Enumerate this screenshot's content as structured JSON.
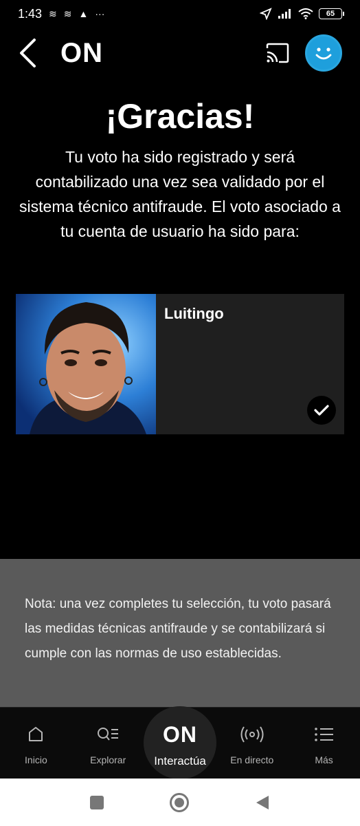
{
  "status_bar": {
    "time": "1:43",
    "left_icons": [
      "layers-icon",
      "layers-icon",
      "warning-icon",
      "more-dots-icon"
    ],
    "right_icons": [
      "location-arrow-icon",
      "signal-icon",
      "wifi-icon"
    ],
    "battery": "65"
  },
  "header": {
    "title": "ON",
    "back_icon": "chevron-left-icon",
    "cast_icon": "cast-icon",
    "avatar_icon": "smiley-avatar-icon",
    "accent_color": "#1e9fdc"
  },
  "confirmation": {
    "title": "¡Gracias!",
    "body": "Tu voto ha sido registrado y será contabilizado una vez sea validado por el sistema técnico antifraude. El voto asociado a tu cuenta de usuario ha sido para:"
  },
  "vote_card": {
    "candidate_name": "Luitingo",
    "selected": true,
    "check_icon": "check-icon"
  },
  "note": {
    "text": "Nota: una vez completes tu selección, tu voto pasará las medidas técnicas antifraude y se contabilizará si cumple con las normas de uso establecidas."
  },
  "bottom_nav": {
    "items": [
      {
        "label": "Inicio",
        "icon": "home-icon"
      },
      {
        "label": "Explorar",
        "icon": "explore-icon"
      },
      {
        "label": "Interactúa",
        "icon": "on-logo-icon",
        "logo_text": "ON",
        "active": true
      },
      {
        "label": "En directo",
        "icon": "live-broadcast-icon"
      },
      {
        "label": "Más",
        "icon": "menu-list-icon"
      }
    ]
  },
  "system_nav": {
    "icons": [
      "recents-square-icon",
      "home-circle-icon",
      "back-triangle-icon"
    ]
  }
}
